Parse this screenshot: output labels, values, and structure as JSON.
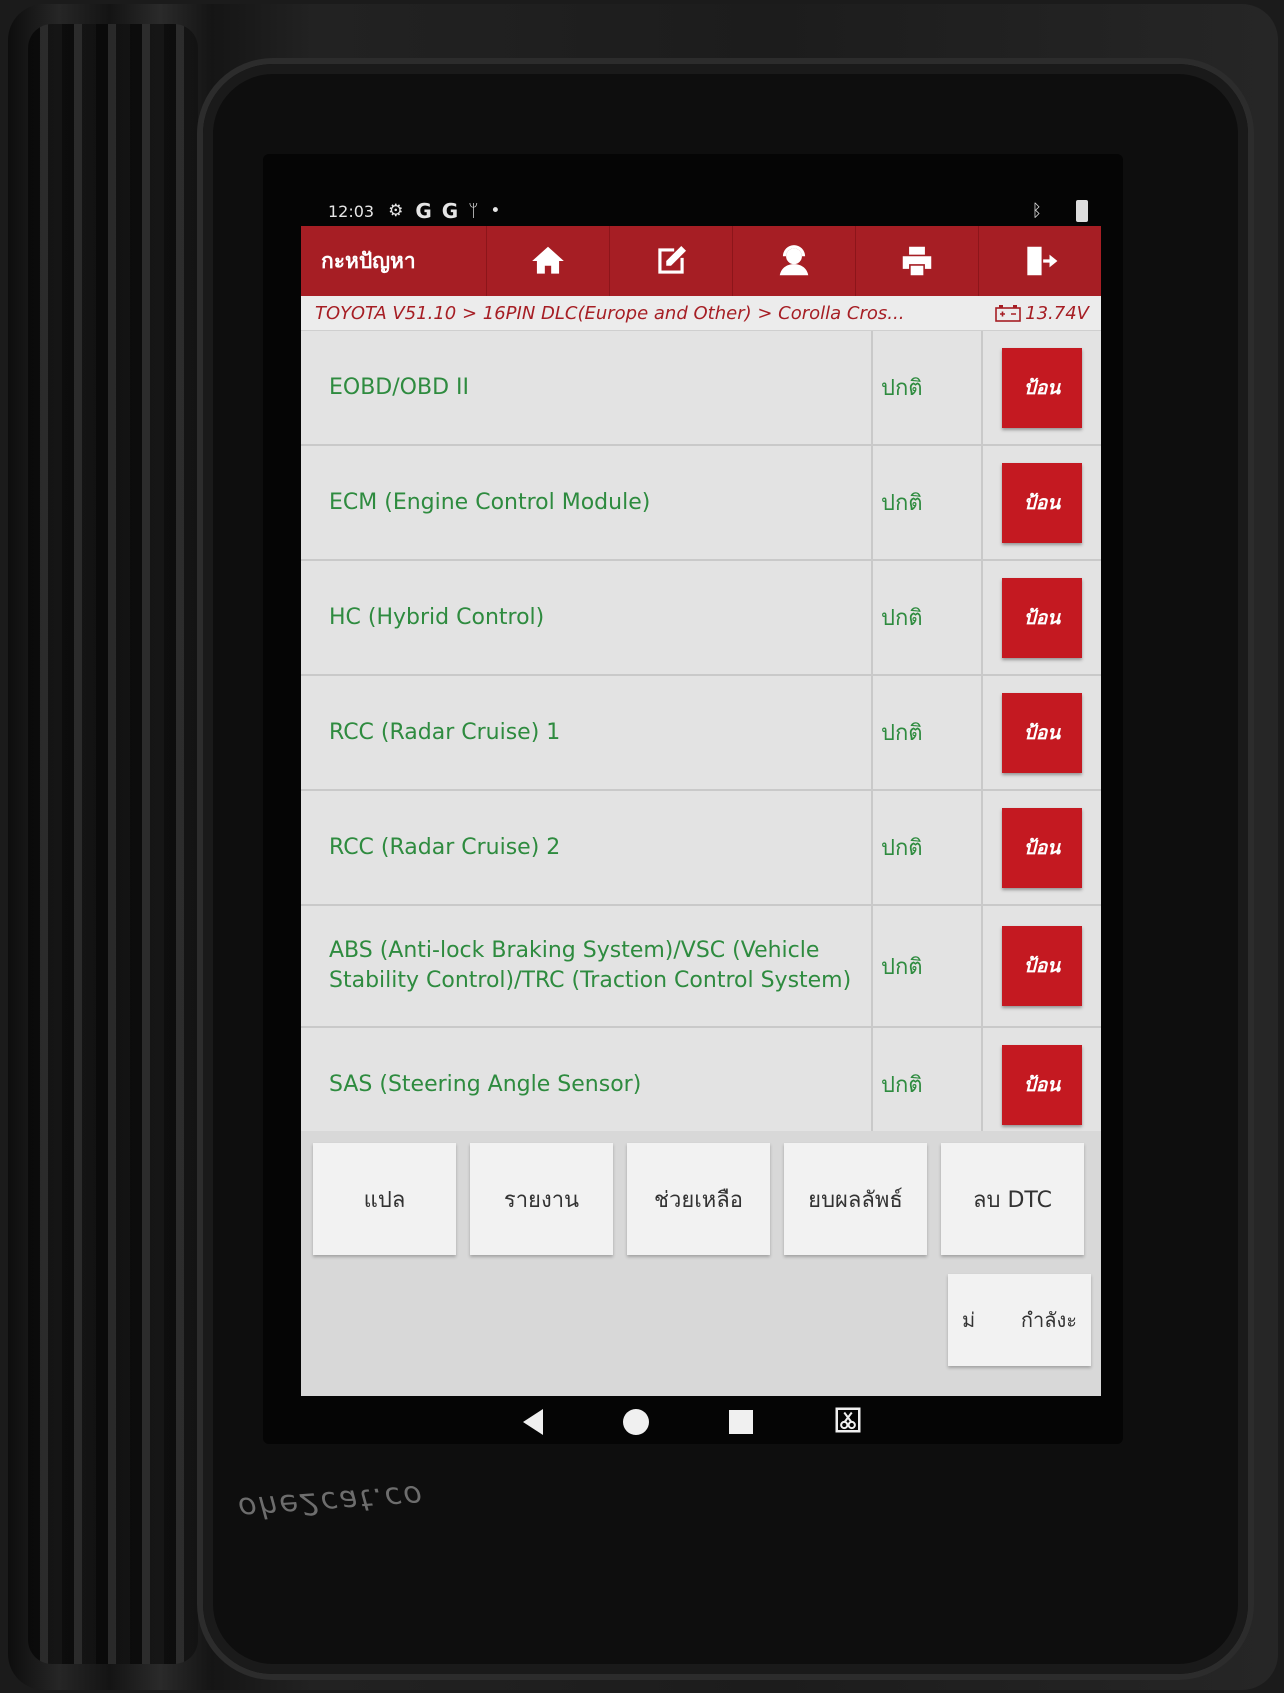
{
  "status_bar": {
    "time": "12:03",
    "icons": [
      "settings-icon",
      "google-icon",
      "google-icon",
      "usb-icon",
      "dot-icon"
    ],
    "g1": "G",
    "g2": "G",
    "right_icons": [
      "bluetooth-icon",
      "battery-icon"
    ]
  },
  "toolbar": {
    "title": "กะหปัญหา",
    "buttons": [
      "home-icon",
      "edit-icon",
      "support-icon",
      "print-icon",
      "exit-icon"
    ]
  },
  "breadcrumb": {
    "path": "TOYOTA V51.10 > 16PIN DLC(Europe and Other) > Corolla Cros...",
    "voltage": "13.74V"
  },
  "systems": [
    {
      "name": "EOBD/OBD II",
      "status": "ปกติ",
      "action": "ป้อน"
    },
    {
      "name": "ECM (Engine Control Module)",
      "status": "ปกติ",
      "action": "ป้อน"
    },
    {
      "name": "HC (Hybrid Control)",
      "status": "ปกติ",
      "action": "ป้อน"
    },
    {
      "name": "RCC (Radar Cruise) 1",
      "status": "ปกติ",
      "action": "ป้อน"
    },
    {
      "name": "RCC (Radar Cruise) 2",
      "status": "ปกติ",
      "action": "ป้อน"
    },
    {
      "name": "ABS (Anti-lock Braking System)/VSC (Vehicle Stability Control)/TRC (Traction Control System)",
      "status": "ปกติ",
      "action": "ป้อน"
    },
    {
      "name": "SAS (Steering Angle Sensor)",
      "status": "ปกติ",
      "action": "ป้อน"
    }
  ],
  "footer_buttons": [
    "แปล",
    "รายงาน",
    "ช่วยเหลือ",
    "ยบผลลัพธ์",
    "ลบ DTC"
  ],
  "mini_button": {
    "left": "ม่",
    "right": "กำลังะ"
  },
  "bezel_brand": "ohe2cat.co"
}
